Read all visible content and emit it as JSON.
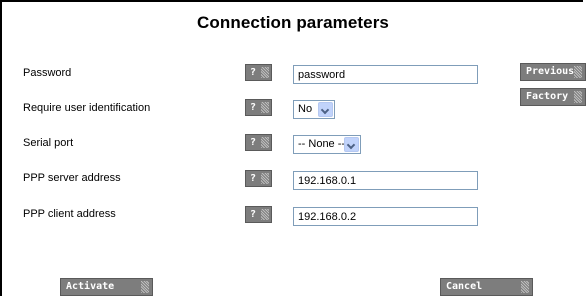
{
  "page": {
    "title": "Connection parameters"
  },
  "form": {
    "rows": [
      {
        "label": "Password",
        "help_label": "?",
        "value": "password"
      },
      {
        "label": "Require user identification",
        "help_label": "?",
        "value": "No"
      },
      {
        "label": "Serial port",
        "help_label": "?",
        "value": "-- None --"
      },
      {
        "label": "PPP server address",
        "help_label": "?",
        "value": "192.168.0.1"
      },
      {
        "label": "PPP client address",
        "help_label": "?",
        "value": "192.168.0.2"
      }
    ]
  },
  "side_buttons": {
    "previous_label": "Previous",
    "factory_label": "Factory"
  },
  "footer": {
    "activate_label": "Activate",
    "cancel_label": "Cancel"
  },
  "colors": {
    "button_gray": "#7d7d7d",
    "input_border": "#7f9db9",
    "select_arrow": "#c1d3fb"
  }
}
